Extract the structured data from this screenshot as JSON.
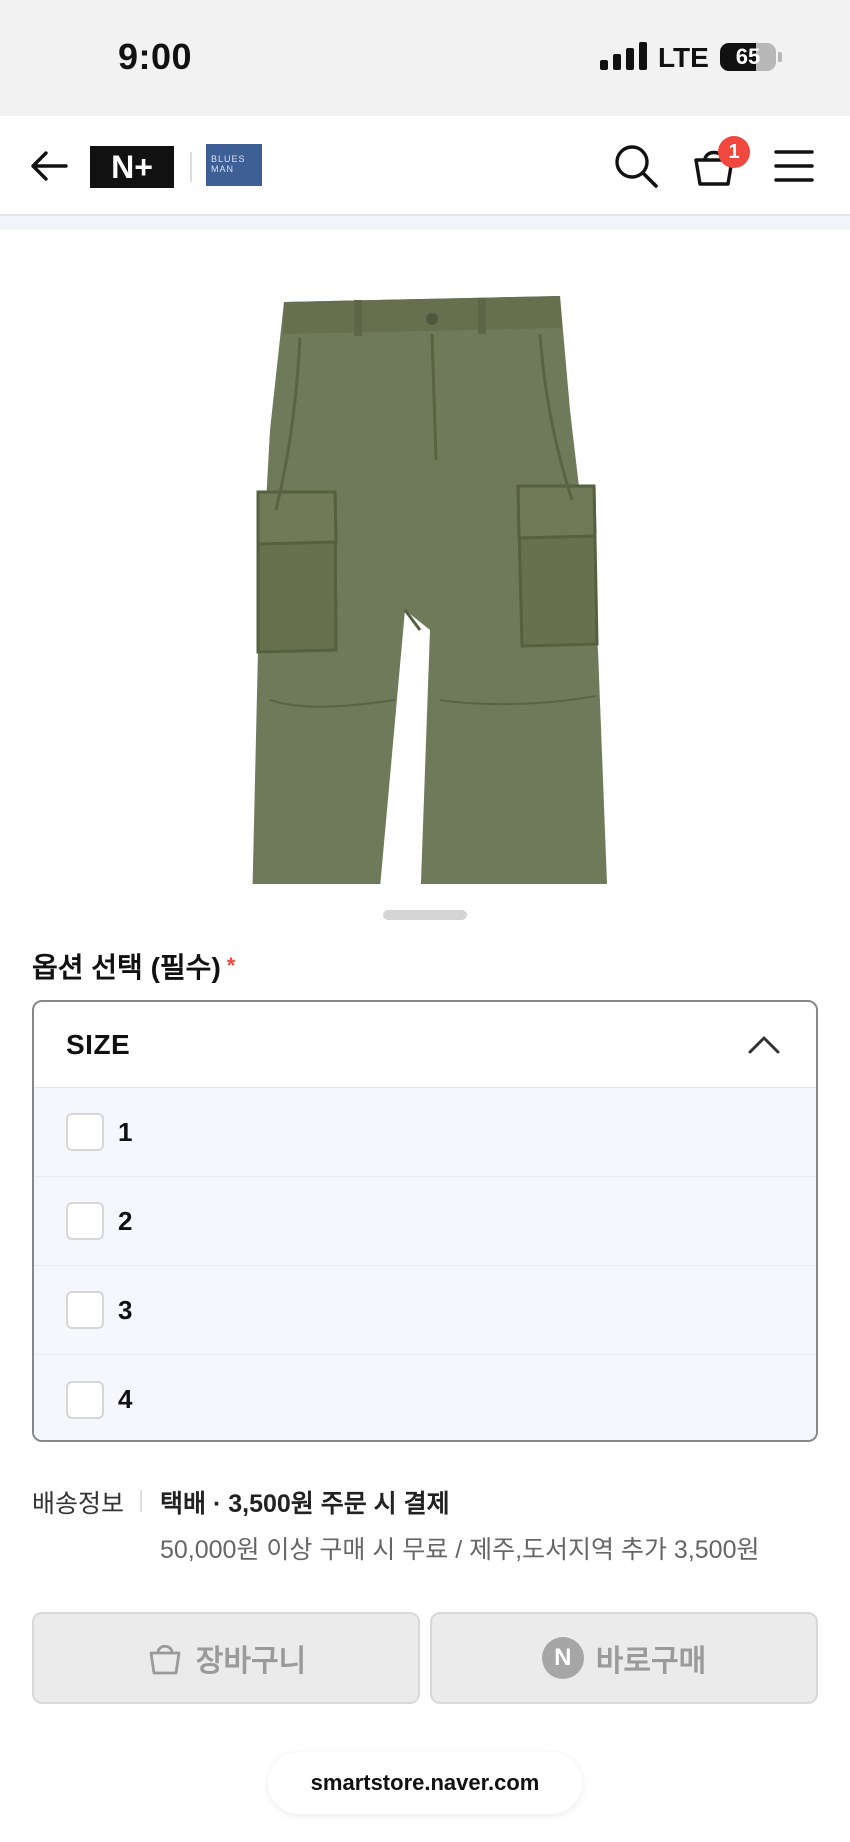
{
  "status_bar": {
    "time": "9:00",
    "network": "LTE",
    "battery": "65",
    "battery_level": 0.65
  },
  "header": {
    "brand_logo_text": "N+",
    "store_logo_text": "BLUES MAN",
    "cart_count": "1",
    "icons": [
      "arrow-left-icon",
      "search-icon",
      "shopping-bag-icon",
      "hamburger-menu-icon"
    ]
  },
  "product_image": {
    "description_icon": "olive-cargo-pants-image"
  },
  "option_sheet": {
    "title": "옵션 선택 (필수)",
    "required_mark": "*",
    "select_label": "SIZE",
    "options": [
      {
        "label": "1",
        "checked": false
      },
      {
        "label": "2",
        "checked": false
      },
      {
        "label": "3",
        "checked": false
      },
      {
        "label": "4",
        "checked": false
      }
    ]
  },
  "shipping": {
    "label": "배송정보",
    "main": "택배 · 3,500원 주문 시 결제",
    "sub": "50,000원 이상 구매 시 무료 / 제주,도서지역 추가 3,500원"
  },
  "actions": {
    "cart_label": "장바구니",
    "buy_label": "바로구매",
    "buy_badge": "N"
  },
  "browser": {
    "domain": "smartstore.naver.com"
  },
  "colors": {
    "accent_red": "#f0483e",
    "pants_olive": "#6f7a5b",
    "logo_blue": "#3e5e96"
  }
}
